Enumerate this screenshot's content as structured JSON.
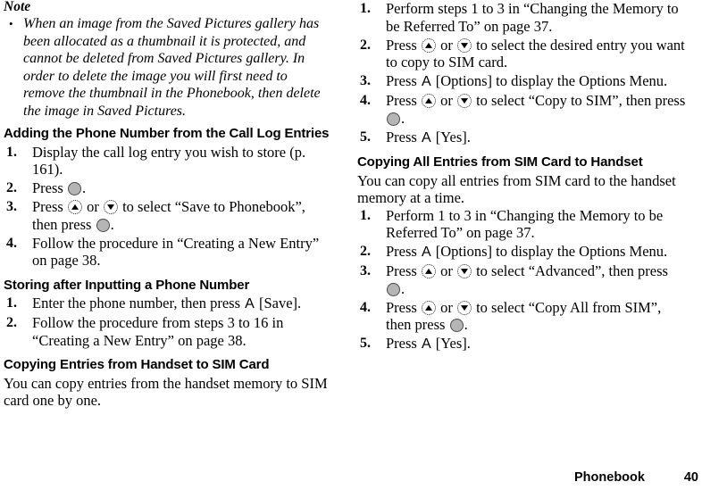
{
  "document": {
    "footer": {
      "section_name": "Phonebook",
      "page_number": "40"
    }
  },
  "left_column": {
    "note": {
      "heading": "Note",
      "bullet_marker": "•",
      "text": "When an image from the Saved Pictures gallery has been allocated as a thumbnail it is protected, and cannot be deleted from Saved Pictures gallery. In order to delete the image you will first need to remove the thumbnail in the Phonebook, then delete the image in Saved Pictures."
    },
    "sections": [
      {
        "heading": "Adding the Phone Number from the Call Log Entries",
        "steps": [
          {
            "num": "1.",
            "parts": [
              {
                "t": "text",
                "v": "Display the call log entry you wish to store (p. 161)."
              }
            ]
          },
          {
            "num": "2.",
            "parts": [
              {
                "t": "text",
                "v": "Press "
              },
              {
                "t": "key-center"
              },
              {
                "t": "text",
                "v": "."
              }
            ]
          },
          {
            "num": "3.",
            "parts": [
              {
                "t": "text",
                "v": "Press "
              },
              {
                "t": "key-up"
              },
              {
                "t": "text",
                "v": " or "
              },
              {
                "t": "key-down"
              },
              {
                "t": "text",
                "v": " to select “Save to Phonebook”, then press "
              },
              {
                "t": "key-center"
              },
              {
                "t": "text",
                "v": "."
              }
            ]
          },
          {
            "num": "4.",
            "parts": [
              {
                "t": "text",
                "v": "Follow the procedure in “Creating a New Entry” on page 38."
              }
            ]
          }
        ]
      },
      {
        "heading": "Storing after Inputting a Phone Number",
        "steps": [
          {
            "num": "1.",
            "parts": [
              {
                "t": "text",
                "v": "Enter the phone number, then press "
              },
              {
                "t": "key-soft",
                "v": "A"
              },
              {
                "t": "text",
                "v": "  [Save]."
              }
            ]
          },
          {
            "num": "2.",
            "parts": [
              {
                "t": "text",
                "v": "Follow the procedure from steps 3 to 16 in “Creating a New Entry” on page 38."
              }
            ]
          }
        ]
      },
      {
        "heading": "Copying Entries from Handset to SIM Card",
        "intro": "You can copy entries from the handset memory to SIM card one by one.",
        "steps": []
      }
    ]
  },
  "right_column": {
    "continued_steps": [
      {
        "num": "1.",
        "parts": [
          {
            "t": "text",
            "v": "Perform steps 1 to 3 in “Changing the Memory to be Referred To” on page 37."
          }
        ]
      },
      {
        "num": "2.",
        "parts": [
          {
            "t": "text",
            "v": "Press "
          },
          {
            "t": "key-up"
          },
          {
            "t": "text",
            "v": " or "
          },
          {
            "t": "key-down"
          },
          {
            "t": "text",
            "v": " to select the desired entry you want to copy to SIM card."
          }
        ]
      },
      {
        "num": "3.",
        "parts": [
          {
            "t": "text",
            "v": "Press "
          },
          {
            "t": "key-soft",
            "v": "A"
          },
          {
            "t": "text",
            "v": "  [Options] to display the Options Menu."
          }
        ]
      },
      {
        "num": "4.",
        "parts": [
          {
            "t": "text",
            "v": "Press "
          },
          {
            "t": "key-up"
          },
          {
            "t": "text",
            "v": " or "
          },
          {
            "t": "key-down"
          },
          {
            "t": "text",
            "v": " to select “Copy to SIM”, then press "
          },
          {
            "t": "key-center"
          },
          {
            "t": "text",
            "v": "."
          }
        ]
      },
      {
        "num": "5.",
        "parts": [
          {
            "t": "text",
            "v": "Press "
          },
          {
            "t": "key-soft",
            "v": "A"
          },
          {
            "t": "text",
            "v": "  [Yes]."
          }
        ]
      }
    ],
    "sections": [
      {
        "heading": "Copying All Entries from SIM Card to Handset",
        "intro": "You can copy all entries from SIM card to the handset memory at a time.",
        "steps": [
          {
            "num": "1.",
            "parts": [
              {
                "t": "text",
                "v": "Perform 1 to 3 in “Changing the Memory to be Referred To” on page 37."
              }
            ]
          },
          {
            "num": "2.",
            "parts": [
              {
                "t": "text",
                "v": "Press "
              },
              {
                "t": "key-soft",
                "v": "A"
              },
              {
                "t": "text",
                "v": "  [Options] to display the Options Menu."
              }
            ]
          },
          {
            "num": "3.",
            "parts": [
              {
                "t": "text",
                "v": "Press "
              },
              {
                "t": "key-up"
              },
              {
                "t": "text",
                "v": " or "
              },
              {
                "t": "key-down"
              },
              {
                "t": "text",
                "v": " to select “Advanced”, then press "
              },
              {
                "t": "key-center"
              },
              {
                "t": "text",
                "v": "."
              }
            ]
          },
          {
            "num": "4.",
            "parts": [
              {
                "t": "text",
                "v": "Press "
              },
              {
                "t": "key-up"
              },
              {
                "t": "text",
                "v": " or "
              },
              {
                "t": "key-down"
              },
              {
                "t": "text",
                "v": " to select “Copy All from SIM”, then press "
              },
              {
                "t": "key-center"
              },
              {
                "t": "text",
                "v": "."
              }
            ]
          },
          {
            "num": "5.",
            "parts": [
              {
                "t": "text",
                "v": "Press "
              },
              {
                "t": "key-soft",
                "v": "A"
              },
              {
                "t": "text",
                "v": "  [Yes]."
              }
            ]
          }
        ]
      }
    ]
  }
}
